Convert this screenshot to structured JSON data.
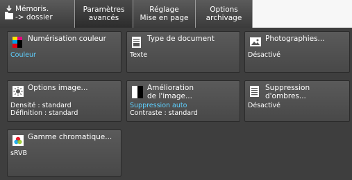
{
  "tabs": [
    {
      "line1": "Mémoris.",
      "line2": "-> dossier"
    },
    {
      "line1": "Paramètres",
      "line2": "avancés"
    },
    {
      "line1": "Réglage",
      "line2": "Mise en page"
    },
    {
      "line1": "Options",
      "line2": "archivage"
    }
  ],
  "tiles": {
    "color_scan": {
      "title": "Numérisation couleur",
      "value": "Couleur"
    },
    "doc_type": {
      "title": "Type de document",
      "value": "Texte"
    },
    "photos": {
      "title": "Photographies...",
      "value": "Désactivé"
    },
    "image_options": {
      "title": "Options image...",
      "value1": "Densité : standard",
      "value2": "Définition : standard"
    },
    "image_enhance": {
      "title_line1": "Amélioration",
      "title_line2": "de l'image...",
      "value1": "Suppression auto",
      "value2": "Contraste : standard"
    },
    "shadow_suppression": {
      "title_line1": "Suppression",
      "title_line2": "d'ombres...",
      "value": "Désactivé"
    },
    "color_gamut": {
      "title": "Gamme chromatique...",
      "value": "sRVB"
    }
  },
  "colors": {
    "value_blue": "#5fd0ff",
    "tile_bg": "#515151",
    "background": "#3e3e3e"
  },
  "icons": [
    "folder-arrow-icon",
    "color-blocks-icon",
    "document-icon",
    "photo-icon",
    "brightness-icon",
    "contrast-icon",
    "document-lines-icon",
    "color-wheel-icon"
  ]
}
